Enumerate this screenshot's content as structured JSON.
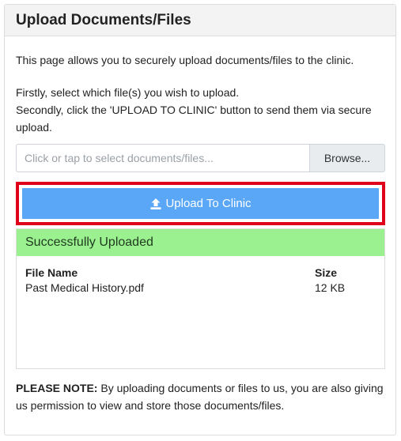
{
  "panel": {
    "title": "Upload Documents/Files"
  },
  "intro": "This page allows you to securely upload documents/files to the clinic.",
  "steps": {
    "line1": "Firstly, select which file(s) you wish to upload.",
    "line2": "Secondly, click the 'UPLOAD TO CLINIC' button to send them via secure upload."
  },
  "file_picker": {
    "placeholder": "Click or tap to select documents/files...",
    "browse_label": "Browse..."
  },
  "upload_button": {
    "label": "Upload To Clinic",
    "icon": "upload-icon",
    "color": "#5aa7f7",
    "highlight_color": "#e1001b"
  },
  "results": {
    "status": "Successfully Uploaded",
    "status_color": "#9bf08f",
    "columns": [
      "File Name",
      "Size"
    ],
    "files": [
      {
        "name": "Past Medical History.pdf",
        "size": "12 KB"
      }
    ]
  },
  "note": {
    "prefix": "PLEASE NOTE:",
    "text": " By uploading documents or files to us, you are also giving us permission to view and store those documents/files."
  }
}
